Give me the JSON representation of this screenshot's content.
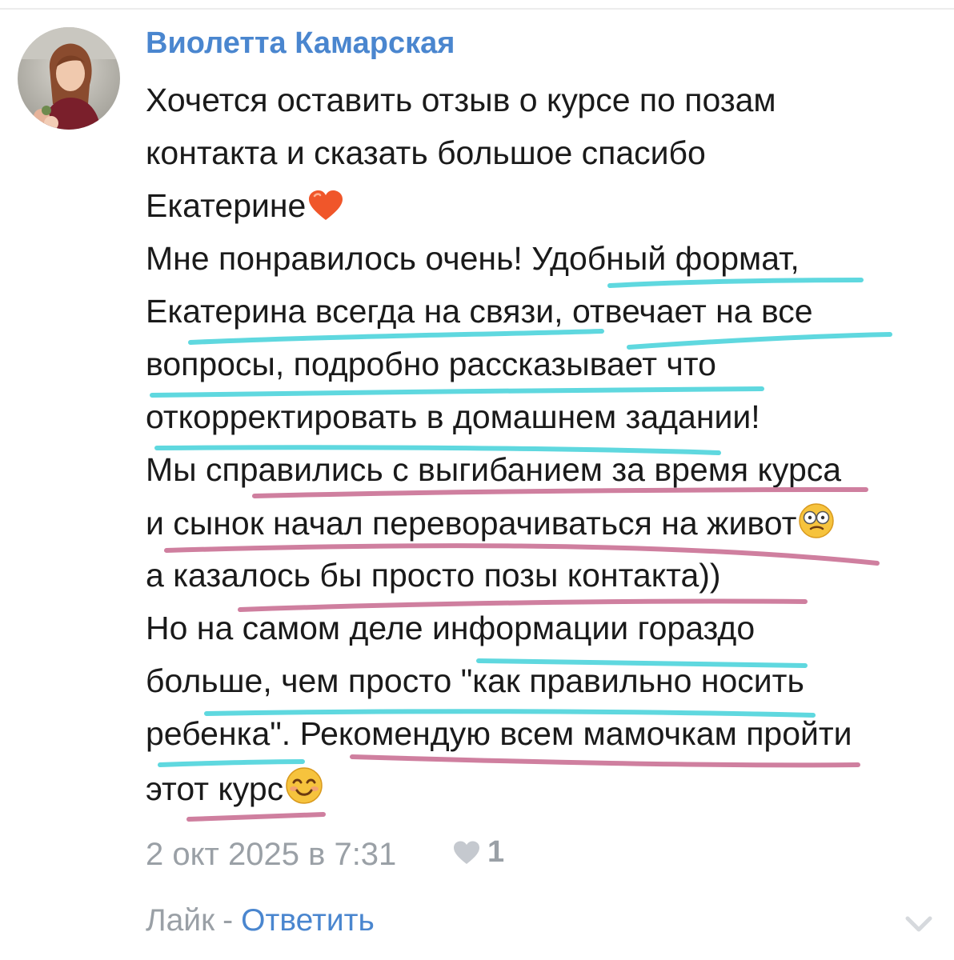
{
  "comment": {
    "author": "Виолетта Камарская",
    "lines": [
      "Хочется оставить отзыв о курсе по позам",
      "контакта и сказать большое спасибо",
      "Екатерине",
      "Мне понравилось очень! Удобный формат,",
      "Екатерина всегда на связи, отвечает на все",
      "вопросы, подробно рассказывает что",
      "откорректировать в домашнем задании!",
      "Мы справились с выгибанием за время курса",
      "и сынок начал переворачиваться на живот",
      "а казалось бы просто позы контакта))",
      "Но на самом деле информации гораздо",
      "больше, чем просто \"как правильно носить",
      "ребенка\". Рекомендую всем мамочкам пройти",
      "этот курс"
    ],
    "emoji": {
      "line_3": "heart-icon",
      "line_9": "dizzy-face-icon",
      "line_14": "smiling-face-icon"
    },
    "timestamp": "2 окт 2025 в 7:31",
    "likes": "1",
    "actions": {
      "like": "Лайк",
      "separator": "-",
      "reply": "Ответить"
    }
  },
  "colors": {
    "author": "#4a86cf",
    "text": "#1a1a1a",
    "meta": "#9aa0a6",
    "highlight_cyan": "#5fd8df",
    "highlight_pink": "#cf7f9f"
  }
}
